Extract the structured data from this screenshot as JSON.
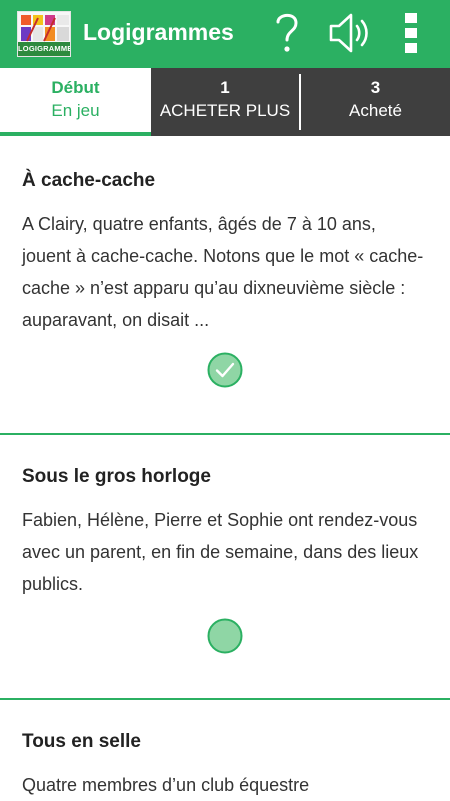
{
  "app": {
    "title": "Logigrammes",
    "logo_text": "LOGIGRAMMES",
    "icons": [
      "help-icon",
      "speaker-icon",
      "overflow-menu-icon"
    ],
    "accent_color": "#2bb062"
  },
  "tabs": [
    {
      "count": "Début",
      "label": "En jeu",
      "active": true
    },
    {
      "count": "1",
      "label": "ACHETER PLUS",
      "active": false
    },
    {
      "count": "3",
      "label": "Acheté",
      "active": false
    }
  ],
  "puzzles": [
    {
      "title": "À cache-cache",
      "text": "A Clairy, quatre enfants, âgés de 7 à 10 ans, jouent à cache-cache. Notons que le mot « cache- cache » n’est apparu qu’au dixneuvième siècle : auparavant, on disait ...",
      "status": "completed"
    },
    {
      "title": "Sous le gros horloge",
      "text": "Fabien, Hélène, Pierre et Sophie ont rendez-vous avec un parent, en fin de semaine, dans des lieux publics.",
      "status": "available"
    },
    {
      "title": "Tous en selle",
      "text": "Quatre membres d’un club équestre",
      "status": "available"
    }
  ]
}
